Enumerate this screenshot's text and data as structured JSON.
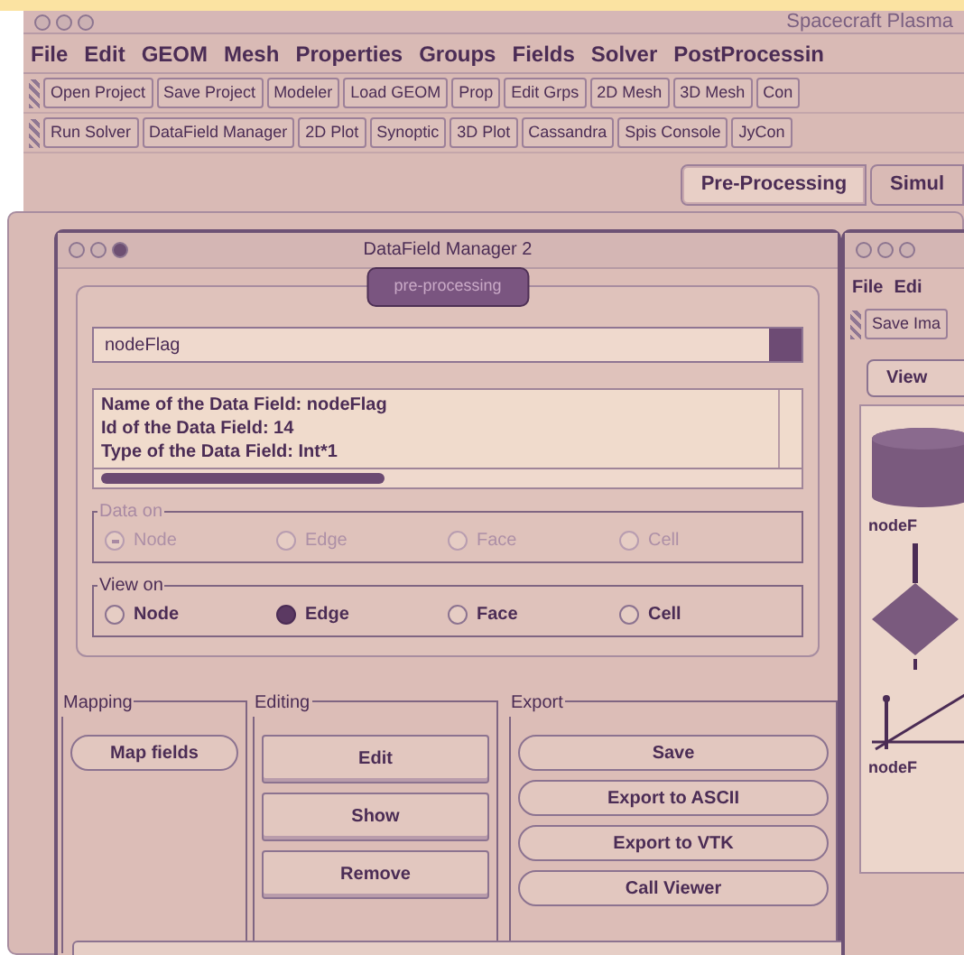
{
  "app": {
    "title": "Spacecraft Plasma",
    "menu": [
      "File",
      "Edit",
      "GEOM",
      "Mesh",
      "Properties",
      "Groups",
      "Fields",
      "Solver",
      "PostProcessin"
    ],
    "toolbar_1": [
      "Open Project",
      "Save Project",
      "Modeler",
      "Load GEOM",
      "Prop",
      "Edit Grps",
      "2D Mesh",
      "3D Mesh",
      "Con"
    ],
    "toolbar_2": [
      "Run Solver",
      "DataField Manager",
      "2D Plot",
      "Synoptic",
      "3D Plot",
      "Cassandra",
      "Spis Console",
      "JyCon"
    ],
    "tabs": [
      {
        "label": "Pre-Processing",
        "selected": true
      },
      {
        "label": "Simul",
        "selected": false
      }
    ]
  },
  "datafield_window": {
    "title": "DataField Manager 2",
    "mode_button": "pre-processing",
    "field_select": "nodeFlag",
    "info_lines": [
      "Name of the Data Field:  nodeFlag",
      "Id of the Data Field:  14",
      "Type of the Data Field:  Int*1"
    ],
    "groups": [
      {
        "legend": "Data on",
        "disabled": true,
        "options": [
          {
            "label": "Node",
            "selected": true
          },
          {
            "label": "Edge",
            "selected": false
          },
          {
            "label": "Face",
            "selected": false
          },
          {
            "label": "Cell",
            "selected": false
          }
        ]
      },
      {
        "legend": "View on",
        "disabled": false,
        "options": [
          {
            "label": "Node",
            "selected": false
          },
          {
            "label": "Edge",
            "selected": true
          },
          {
            "label": "Face",
            "selected": false
          },
          {
            "label": "Cell",
            "selected": false
          }
        ]
      }
    ],
    "mapping": {
      "legend": "Mapping",
      "buttons": [
        "Map fields"
      ]
    },
    "editing": {
      "legend": "Editing",
      "buttons": [
        "Edit",
        "Show",
        "Remove"
      ]
    },
    "export": {
      "legend": "Export",
      "buttons": [
        "Save",
        "Export to ASCII",
        "Export to VTK",
        "Call Viewer"
      ]
    }
  },
  "viewer_window": {
    "menu": [
      "File",
      "Edi"
    ],
    "toolbar": [
      "Save Ima"
    ],
    "tab": "View",
    "node_labels": [
      "nodeF",
      "nodeF"
    ]
  }
}
